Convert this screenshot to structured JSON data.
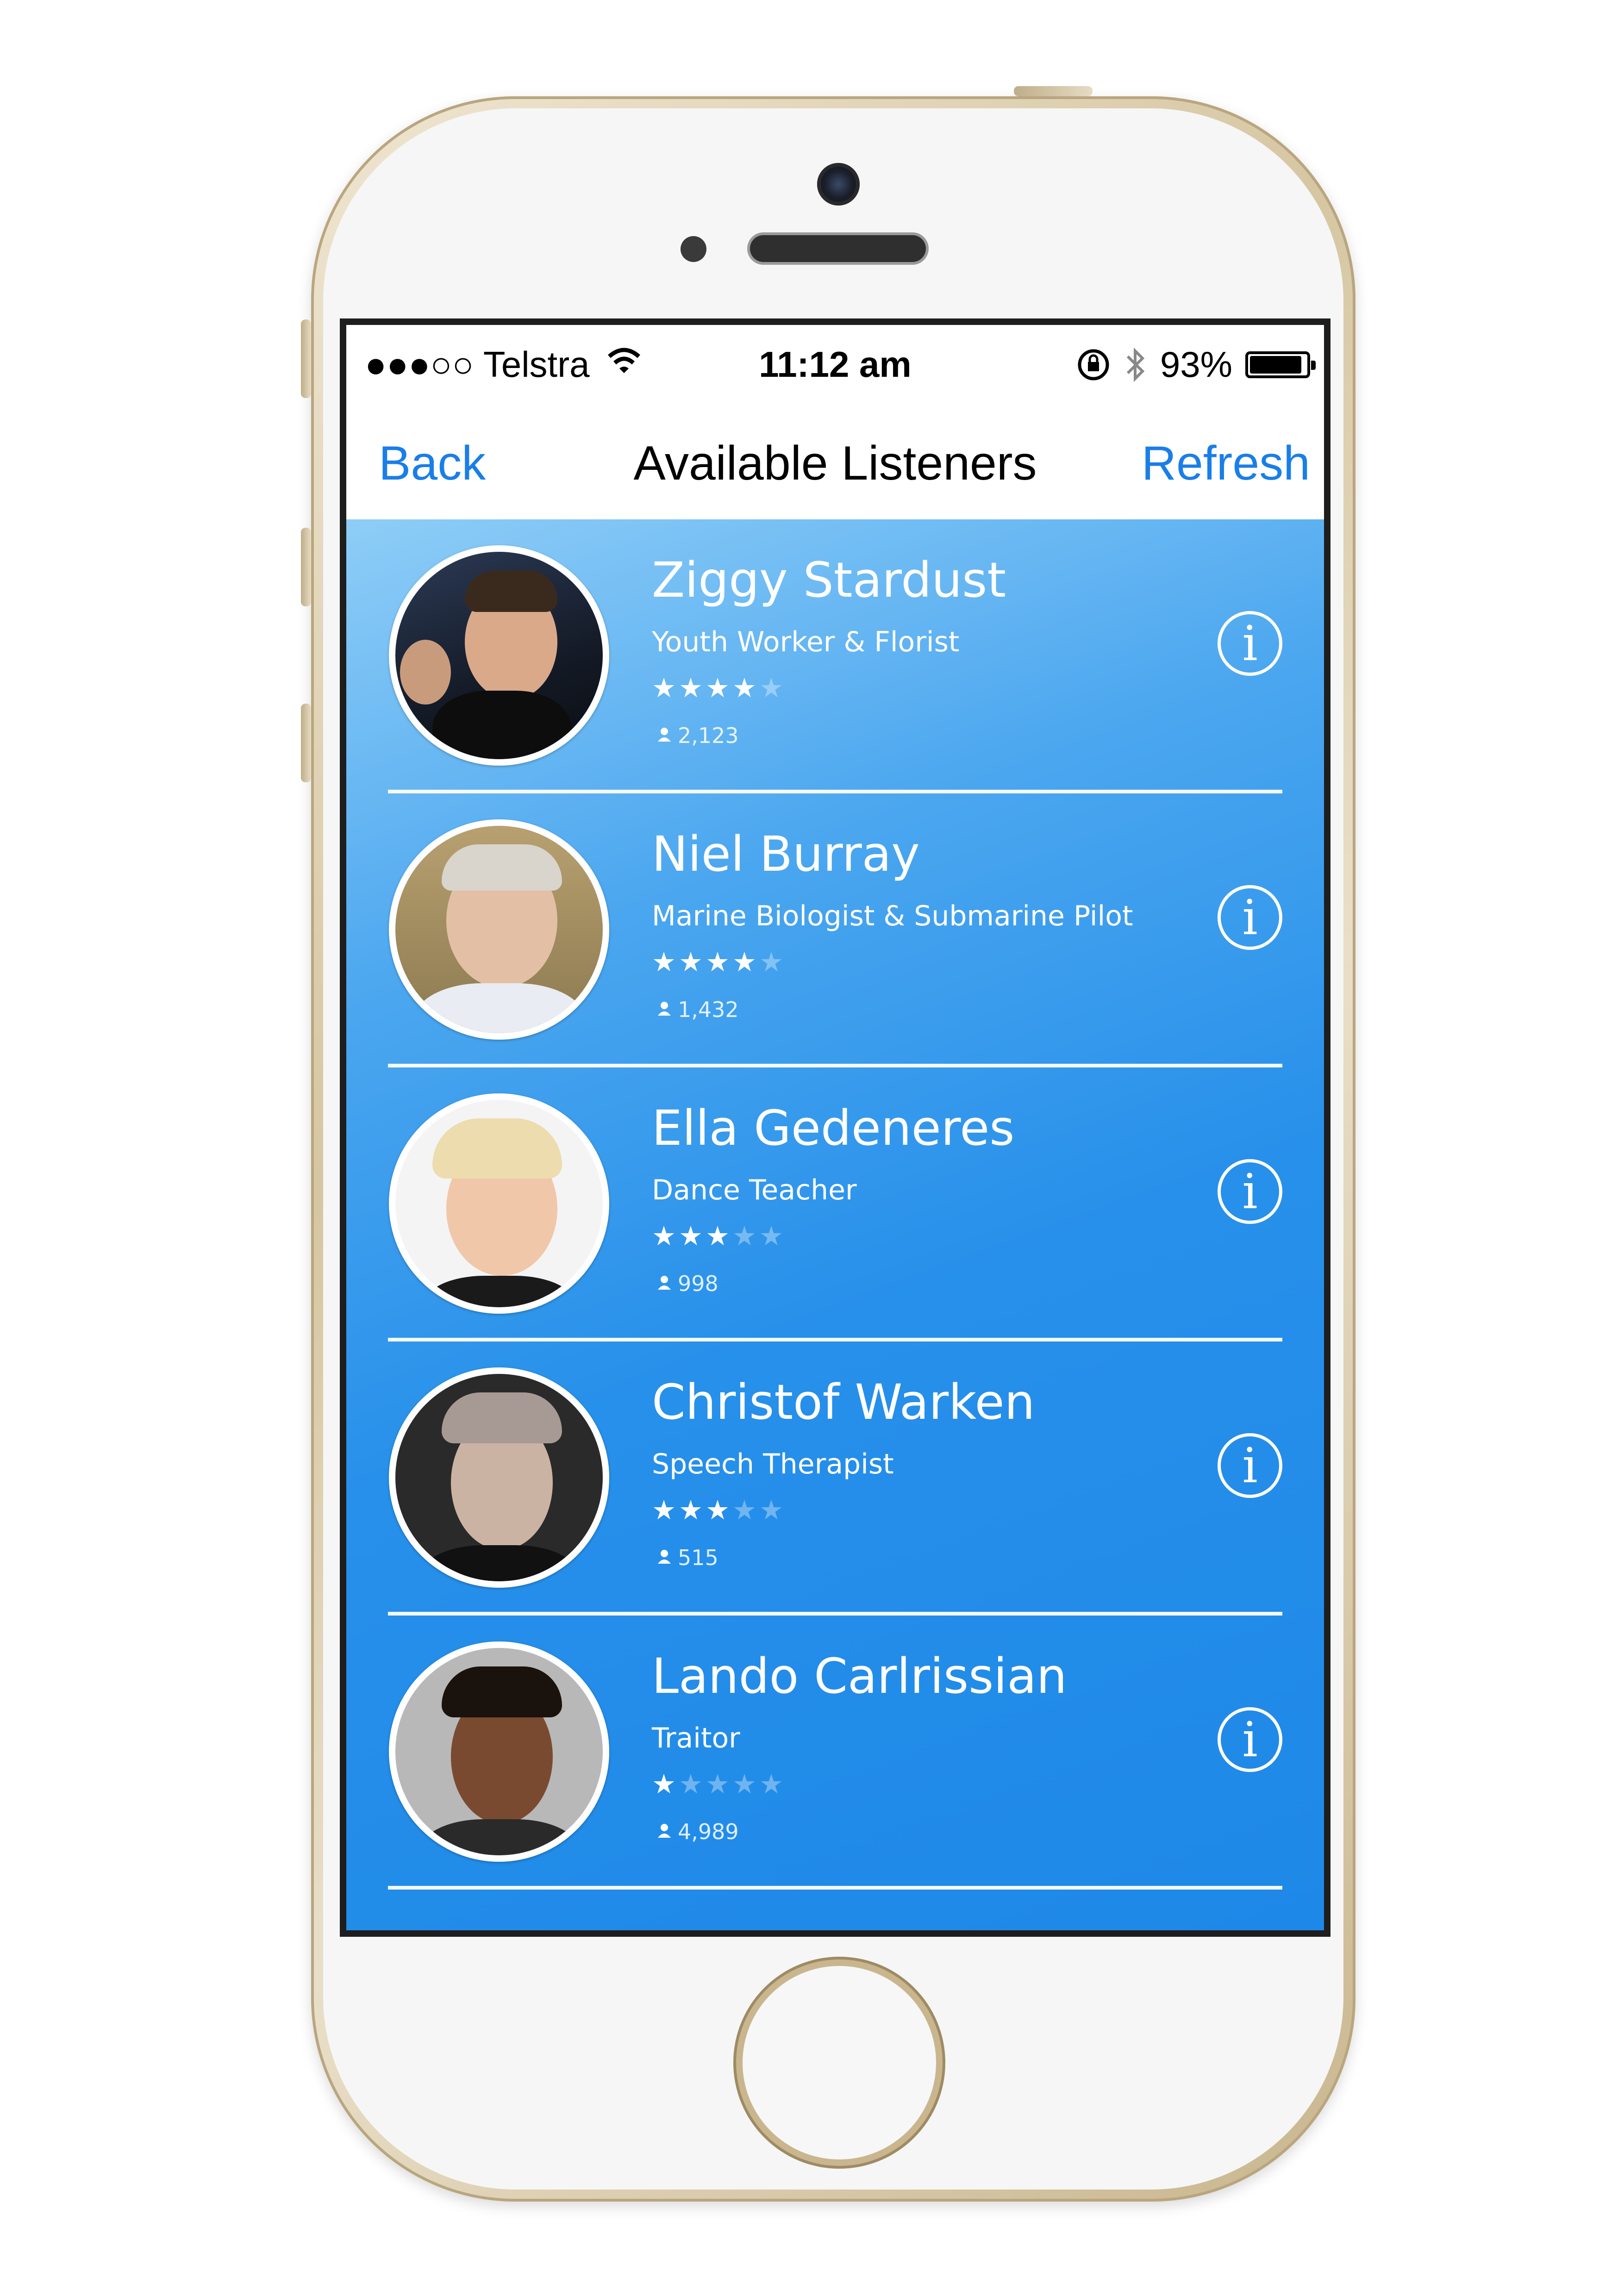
{
  "status_bar": {
    "carrier": "●●●○○ Telstra",
    "time": "11:12 am",
    "battery": "93%",
    "battery_level": 0.93
  },
  "nav": {
    "back_label": "Back",
    "title": "Available Listeners",
    "refresh_label": "Refresh"
  },
  "listeners": [
    {
      "name": "Ziggy Stardust",
      "job": "Youth Worker & Florist",
      "rating": 4,
      "rating_max": 5,
      "count": "2,123"
    },
    {
      "name": "Niel Burray",
      "job": "Marine Biologist & Submarine Pilot",
      "rating": 4,
      "rating_max": 5,
      "count": "1,432"
    },
    {
      "name": "Ella Gedeneres",
      "job": "Dance Teacher",
      "rating": 3,
      "rating_max": 5,
      "count": "998"
    },
    {
      "name": "Christof Warken",
      "job": "Speech Therapist",
      "rating": 3,
      "rating_max": 5,
      "count": "515"
    },
    {
      "name": "Lando Carlrissian",
      "job": "Traitor",
      "rating": 1,
      "rating_max": 5,
      "count": "4,989"
    }
  ],
  "icons": {
    "info": "info-circle-icon",
    "user": "user-icon",
    "star": "star-icon"
  },
  "colors": {
    "accent": "#1a7ee8",
    "list_top": "#8ecdf7",
    "list_bottom": "#1e88e8"
  }
}
